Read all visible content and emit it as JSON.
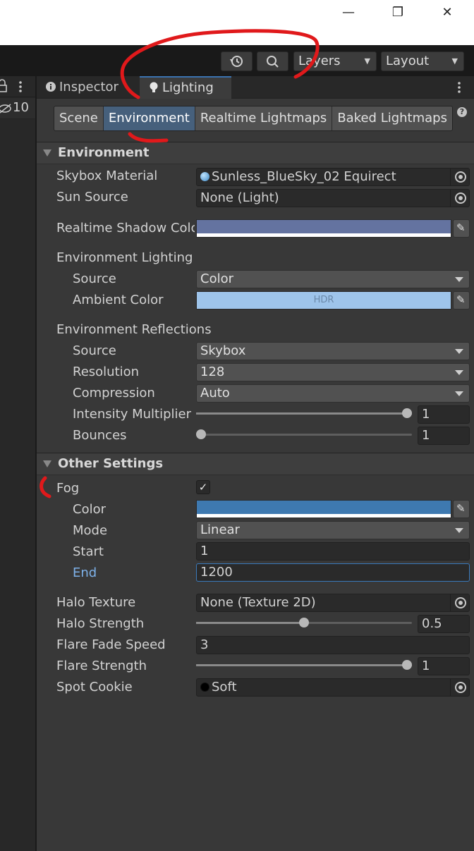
{
  "window": {
    "minimize_glyph": "—",
    "maximize_glyph": "❐",
    "close_glyph": "✕"
  },
  "toolbar": {
    "layers_label": "Layers",
    "layout_label": "Layout"
  },
  "left_panel": {
    "hidden_count": "10"
  },
  "tabs": [
    {
      "label": "Inspector",
      "icon": "info-icon"
    },
    {
      "label": "Lighting",
      "icon": "lightbulb-icon"
    }
  ],
  "subtabs": [
    "Scene",
    "Environment",
    "Realtime Lightmaps",
    "Baked Lightmaps"
  ],
  "environment": {
    "header": "Environment",
    "skybox_material": {
      "label": "Skybox Material",
      "value": "Sunless_BlueSky_02 Equirect"
    },
    "sun_source": {
      "label": "Sun Source",
      "value": "None (Light)"
    },
    "realtime_shadow_color": {
      "label": "Realtime Shadow Colc",
      "color": "#6473a0"
    },
    "env_lighting_header": "Environment Lighting",
    "lighting_source": {
      "label": "Source",
      "value": "Color"
    },
    "ambient_color": {
      "label": "Ambient Color",
      "color": "#9ec4ea",
      "badge": "HDR"
    },
    "env_reflections_header": "Environment Reflections",
    "reflection_source": {
      "label": "Source",
      "value": "Skybox"
    },
    "resolution": {
      "label": "Resolution",
      "value": "128"
    },
    "compression": {
      "label": "Compression",
      "value": "Auto"
    },
    "intensity_multiplier": {
      "label": "Intensity Multiplier",
      "value": "1",
      "fraction": 1.0
    },
    "bounces": {
      "label": "Bounces",
      "value": "1",
      "fraction": 0.0
    }
  },
  "other_settings": {
    "header": "Other Settings",
    "fog": {
      "label": "Fog",
      "checked": true,
      "check_glyph": "✓"
    },
    "fog_color": {
      "label": "Color",
      "color": "#3e79b0"
    },
    "fog_mode": {
      "label": "Mode",
      "value": "Linear"
    },
    "fog_start": {
      "label": "Start",
      "value": "1"
    },
    "fog_end": {
      "label": "End",
      "value": "1200"
    },
    "halo_texture": {
      "label": "Halo Texture",
      "value": "None (Texture 2D)"
    },
    "halo_strength": {
      "label": "Halo Strength",
      "value": "0.5",
      "fraction": 0.5
    },
    "flare_fade_speed": {
      "label": "Flare Fade Speed",
      "value": "3"
    },
    "flare_strength": {
      "label": "Flare Strength",
      "value": "1",
      "fraction": 1.0
    },
    "spot_cookie": {
      "label": "Spot Cookie",
      "value": "Soft"
    }
  },
  "colors": {
    "accent": "#46607c",
    "annotation": "#e0191b"
  }
}
